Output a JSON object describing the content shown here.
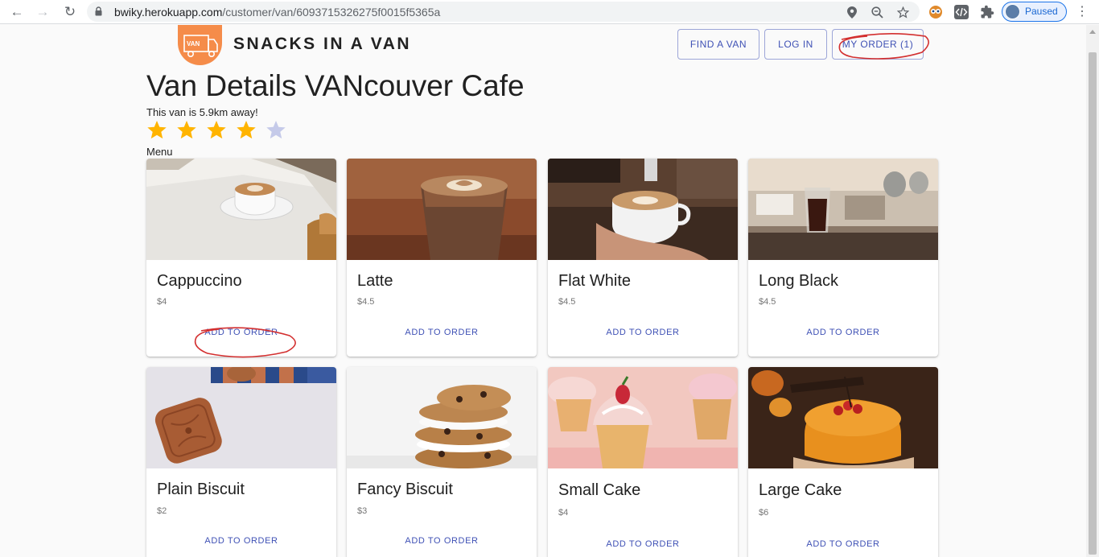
{
  "browser": {
    "url_host": "bwiky.herokuapp.com",
    "url_path": "/customer/van/6093715326275f0015f5365a",
    "profile_status": "Paused"
  },
  "header": {
    "brand": "SNACKS IN A VAN",
    "logo_text": "VAN",
    "nav": {
      "find_van": "FIND A VAN",
      "log_in": "LOG IN",
      "my_order": "MY ORDER (1)"
    }
  },
  "van": {
    "title": "Van Details VANcouver Cafe",
    "distance_text": "This van is 5.9km away!",
    "rating": 4,
    "rating_max": 5,
    "menu_label": "Menu"
  },
  "menu_items": [
    {
      "name": "Cappuccino",
      "price": "$4",
      "action": "ADD TO ORDER"
    },
    {
      "name": "Latte",
      "price": "$4.5",
      "action": "ADD TO ORDER"
    },
    {
      "name": "Flat White",
      "price": "$4.5",
      "action": "ADD TO ORDER"
    },
    {
      "name": "Long Black",
      "price": "$4.5",
      "action": "ADD TO ORDER"
    },
    {
      "name": "Plain Biscuit",
      "price": "$2",
      "action": "ADD TO ORDER"
    },
    {
      "name": "Fancy Biscuit",
      "price": "$3",
      "action": "ADD TO ORDER"
    },
    {
      "name": "Small Cake",
      "price": "$4",
      "action": "ADD TO ORDER"
    },
    {
      "name": "Large Cake",
      "price": "$6",
      "action": "ADD TO ORDER"
    }
  ],
  "colors": {
    "accent": "#3f51b5",
    "star_filled": "#ffb400",
    "star_empty": "#c5cae9",
    "logo": "#f58c4a",
    "annotation": "#d32f2f"
  }
}
